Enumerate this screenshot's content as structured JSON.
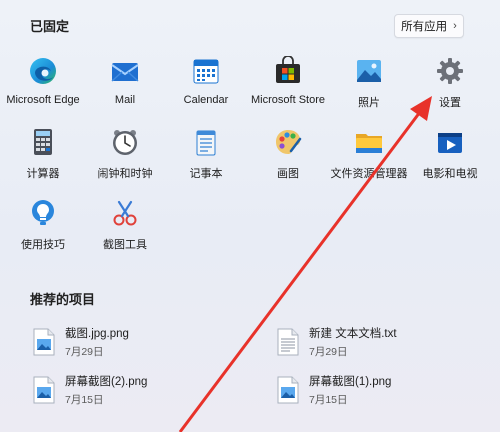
{
  "pinned": {
    "title": "已固定",
    "all_apps_label": "所有应用",
    "apps": [
      {
        "label": "Microsoft Edge",
        "icon": "edge-icon"
      },
      {
        "label": "Mail",
        "icon": "mail-icon"
      },
      {
        "label": "Calendar",
        "icon": "calendar-icon"
      },
      {
        "label": "Microsoft Store",
        "icon": "store-icon"
      },
      {
        "label": "照片",
        "icon": "photos-icon"
      },
      {
        "label": "设置",
        "icon": "gear-icon"
      },
      {
        "label": "计算器",
        "icon": "calculator-icon"
      },
      {
        "label": "闹钟和时钟",
        "icon": "clock-icon"
      },
      {
        "label": "记事本",
        "icon": "notepad-icon"
      },
      {
        "label": "画图",
        "icon": "paint-icon"
      },
      {
        "label": "文件资源管理器",
        "icon": "folder-icon"
      },
      {
        "label": "电影和电视",
        "icon": "movies-icon"
      },
      {
        "label": "使用技巧",
        "icon": "tips-icon"
      },
      {
        "label": "截图工具",
        "icon": "snipping-tool-icon"
      }
    ]
  },
  "recommended": {
    "title": "推荐的项目",
    "items": [
      {
        "name": "截图.jpg.png",
        "date": "7月29日",
        "icon": "image-file-icon"
      },
      {
        "name": "新建 文本文档.txt",
        "date": "7月29日",
        "icon": "text-file-icon"
      },
      {
        "name": "屏幕截图(2).png",
        "date": "7月15日",
        "icon": "image-file-icon"
      },
      {
        "name": "屏幕截图(1).png",
        "date": "7月15日",
        "icon": "image-file-icon"
      }
    ]
  },
  "colors": {
    "arrow": "#e8322a",
    "accent": "#0a64c8"
  }
}
